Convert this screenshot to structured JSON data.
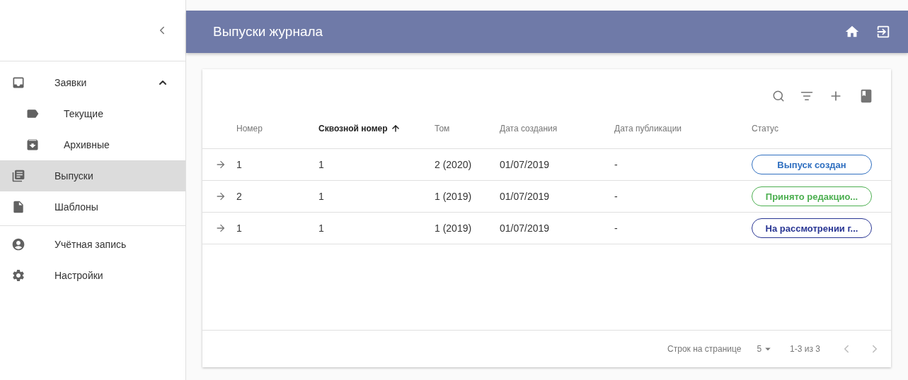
{
  "sidebar": {
    "items": [
      {
        "label": "Заявки",
        "selected": false,
        "expanded": true,
        "children": [
          {
            "label": "Текущие",
            "selected": false
          },
          {
            "label": "Архивные",
            "selected": false
          }
        ]
      },
      {
        "label": "Выпуски",
        "selected": true
      },
      {
        "label": "Шаблоны",
        "selected": false
      },
      {
        "kind": "divider"
      },
      {
        "label": "Учётная запись",
        "selected": false
      },
      {
        "label": "Настройки",
        "selected": false
      }
    ]
  },
  "header": {
    "title": "Выпуски журнала"
  },
  "table": {
    "columns": [
      {
        "label": "Номер",
        "sorted": false
      },
      {
        "label": "Сквозной номер",
        "sorted": true
      },
      {
        "label": "Том",
        "sorted": false
      },
      {
        "label": "Дата создания",
        "sorted": false
      },
      {
        "label": "Дата публикации",
        "sorted": false
      },
      {
        "label": "Статус",
        "sorted": false
      }
    ],
    "rows": [
      {
        "cells": [
          "1",
          "1",
          "2 (2020)",
          "01/07/2019",
          "-"
        ],
        "status": "Выпуск создан",
        "color": "#2f6fc0"
      },
      {
        "cells": [
          "2",
          "1",
          "1 (2019)",
          "01/07/2019",
          "-"
        ],
        "status": "Принято редакцио...",
        "color": "#4caf50"
      },
      {
        "cells": [
          "1",
          "1",
          "1 (2019)",
          "01/07/2019",
          "-"
        ],
        "status": "На рассмотрении г...",
        "color": "#283593"
      }
    ]
  },
  "pagination": {
    "rows_label": "Строк на странице",
    "rows_per_page": "5",
    "range": "1-3 из 3"
  }
}
